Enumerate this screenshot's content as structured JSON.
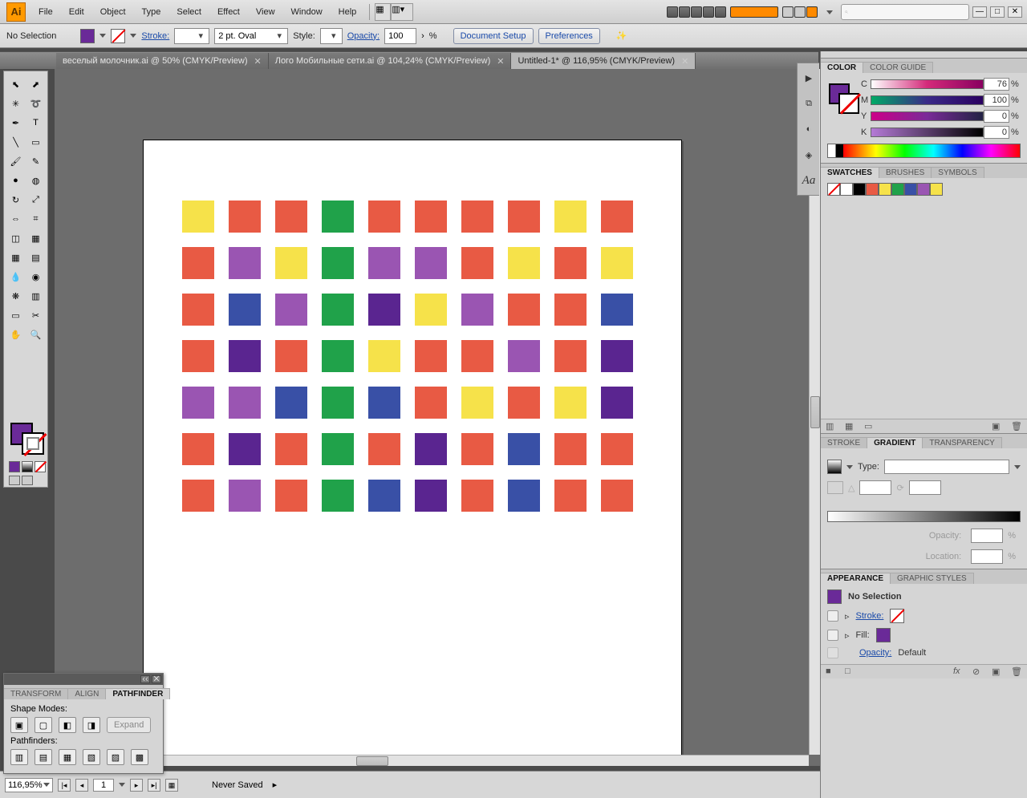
{
  "app": {
    "icon_text": "Ai"
  },
  "menu": [
    "File",
    "Edit",
    "Object",
    "Type",
    "Select",
    "Effect",
    "View",
    "Window",
    "Help"
  ],
  "search": {
    "placeholder": ""
  },
  "control": {
    "selection": "No Selection",
    "stroke_label": "Stroke:",
    "stroke_weight": "2 pt. Oval",
    "style_label": "Style:",
    "opacity_label": "Opacity:",
    "opacity_value": "100",
    "opacity_pct": "%",
    "doc_setup": "Document Setup",
    "preferences": "Preferences"
  },
  "tabs": [
    {
      "label": "веселый молочник.ai @ 50% (CMYK/Preview)",
      "active": false
    },
    {
      "label": "Лого Мобильные сети.ai @ 104,24% (CMYK/Preview)",
      "active": false
    },
    {
      "label": "Untitled-1* @ 116,95% (CMYK/Preview)",
      "active": true
    }
  ],
  "status": {
    "zoom": "116,95%",
    "artboard": "1",
    "save_state": "Never Saved"
  },
  "panels": {
    "color": {
      "tab_color": "COLOR",
      "tab_guide": "COLOR GUIDE",
      "rows": [
        {
          "ch": "C",
          "val": "76",
          "grad": "linear-gradient(90deg,#fff,#d42a7a,#890060)"
        },
        {
          "ch": "M",
          "val": "100",
          "grad": "linear-gradient(90deg,#0a6,#3a2a88,#2a0060)"
        },
        {
          "ch": "Y",
          "val": "0",
          "grad": "linear-gradient(90deg,#c08,#7a2a98,#224)"
        },
        {
          "ch": "K",
          "val": "0",
          "grad": "linear-gradient(90deg,#b47ad6,#000)"
        }
      ],
      "pct": "%"
    },
    "swatches": {
      "tab_sw": "SWATCHES",
      "tab_br": "BRUSHES",
      "tab_sy": "SYMBOLS",
      "colors": [
        "none",
        "#ffffff",
        "#000000",
        "#e85a44",
        "#f6e24a",
        "#20a24a",
        "#3950a6",
        "#9a55b2",
        "#f6e24a"
      ]
    },
    "gradient": {
      "tab_st": "STROKE",
      "tab_gr": "GRADIENT",
      "tab_tr": "TRANSPARENCY",
      "type_label": "Type:",
      "opacity_label": "Opacity:",
      "opacity_pct": "%",
      "location_label": "Location:",
      "location_pct": "%"
    },
    "appearance": {
      "tab_ap": "APPEARANCE",
      "tab_gs": "GRAPHIC STYLES",
      "header": "No Selection",
      "stroke_label": "Stroke:",
      "fill_label": "Fill:",
      "opacity_label": "Opacity:",
      "opacity_value": "Default"
    }
  },
  "pathfinder": {
    "tab_tr": "TRANSFORM",
    "tab_al": "ALIGN",
    "tab_pf": "PATHFINDER",
    "shape_modes": "Shape Modes:",
    "pathfinders": "Pathfinders:",
    "expand": "Expand"
  },
  "grid": {
    "palette": {
      "o": "#e85a44",
      "y": "#f6e24a",
      "g": "#20a24a",
      "p": "#9a55b2",
      "v": "#5a2590",
      "b": "#3950a6"
    },
    "rows": [
      [
        "y",
        "o",
        "o",
        "g",
        "o",
        "o",
        "o",
        "o",
        "y",
        "o"
      ],
      [
        "o",
        "p",
        "y",
        "g",
        "p",
        "p",
        "o",
        "y",
        "o",
        "y"
      ],
      [
        "o",
        "b",
        "p",
        "g",
        "v",
        "y",
        "p",
        "o",
        "o",
        "b"
      ],
      [
        "o",
        "v",
        "o",
        "g",
        "y",
        "o",
        "o",
        "p",
        "o",
        "v"
      ],
      [
        "p",
        "p",
        "b",
        "g",
        "b",
        "o",
        "y",
        "o",
        "y",
        "v"
      ],
      [
        "o",
        "v",
        "o",
        "g",
        "o",
        "v",
        "o",
        "b",
        "o",
        "o"
      ],
      [
        "o",
        "p",
        "o",
        "g",
        "b",
        "v",
        "o",
        "b",
        "o",
        "o"
      ]
    ]
  }
}
